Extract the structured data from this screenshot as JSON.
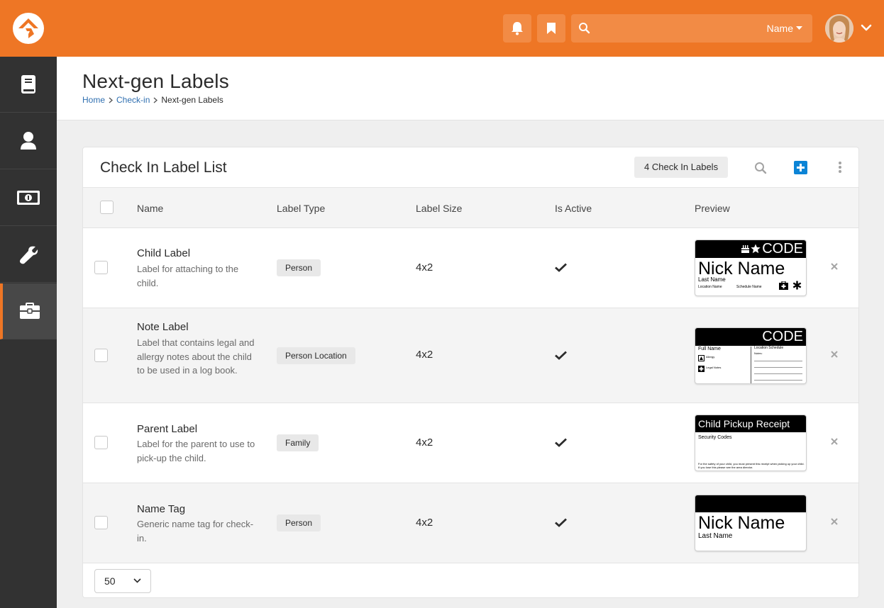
{
  "header": {
    "search_placeholder": "",
    "search_scope": "Name",
    "brand_color": "#ee7625"
  },
  "sidebar": {
    "items": [
      {
        "icon": "book-icon"
      },
      {
        "icon": "person-icon"
      },
      {
        "icon": "money-icon"
      },
      {
        "icon": "wrench-icon"
      },
      {
        "icon": "briefcase-icon",
        "active": true
      }
    ]
  },
  "page": {
    "title": "Next-gen Labels",
    "breadcrumb": [
      "Home",
      "Check-in",
      "Next-gen Labels"
    ]
  },
  "panel": {
    "title": "Check In Label List",
    "count_label": "4 Check In Labels",
    "columns": [
      "Name",
      "Label Type",
      "Label Size",
      "Is Active",
      "Preview"
    ],
    "rows": [
      {
        "name": "Child Label",
        "description": "Label for attaching to the child.",
        "type": "Person",
        "size": "4x2",
        "active": true,
        "preview": {
          "code": "CODE",
          "nick": "Nick Name",
          "last": "Last Name",
          "location": "Location Name",
          "schedule": "Schedule Name"
        }
      },
      {
        "name": "Note Label",
        "description": "Label that contains legal and allergy notes about the child to be used in a log book.",
        "type": "Person Location",
        "size": "4x2",
        "active": true,
        "preview": {
          "code": "CODE",
          "full_name": "Full Name",
          "location_schedule": "Location Schedule",
          "allergy": "Allergy",
          "legal": "Legal Notes",
          "notes": "Notes:"
        }
      },
      {
        "name": "Parent Label",
        "description": "Label for the parent to use to pick-up the child.",
        "type": "Family",
        "size": "4x2",
        "active": true,
        "preview": {
          "title": "Child Pickup Receipt",
          "subtitle": "Security Codes",
          "footer": "For the safety of your child, you must present this receipt when picking up your child. If you lose this please see the area director."
        }
      },
      {
        "name": "Name Tag",
        "description": "Generic name tag for check-in.",
        "type": "Person",
        "size": "4x2",
        "active": true,
        "preview": {
          "nick": "Nick Name",
          "last": "Last Name"
        }
      }
    ]
  },
  "footer": {
    "page_size": "50"
  }
}
